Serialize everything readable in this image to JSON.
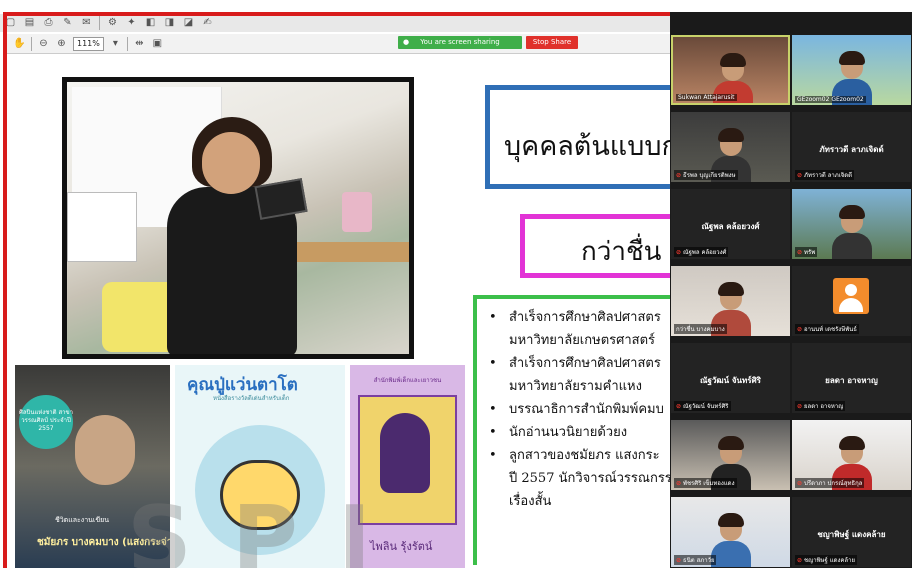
{
  "toolbar": {
    "zoom": "111%",
    "share_status": "You are screen sharing",
    "stop_share": "Stop Share"
  },
  "slide": {
    "title_line1": "บุคคลต้นแบบกา",
    "title_line2": "กว่าชื่น",
    "bio": [
      {
        "text": "สำเร็จการศึกษาศิลปศาสตร",
        "bullet": true
      },
      {
        "text": "มหาวิทยาลัยเกษตรศาสตร์",
        "bullet": false
      },
      {
        "text": "สำเร็จการศึกษาศิลปศาสตร",
        "bullet": true
      },
      {
        "text": "มหาวิทยาลัยรามคำแหง",
        "bullet": false
      },
      {
        "text": "บรรณาธิการสำนักพิมพ์คมบ",
        "bullet": true
      },
      {
        "text": "นักอ่านนวนิยายด้วยง",
        "bullet": true
      },
      {
        "text": "ลูกสาวของชมัยภร แสงกระ",
        "bullet": true
      },
      {
        "text": "ปี 2557 นักวิจารณ์วรรณกรร",
        "bullet": false
      },
      {
        "text": "เรื่องสั้น",
        "bullet": false
      }
    ],
    "book1": {
      "badge": "ศิลปินแห่งชาติ สาขาวรรณศิลป์ ประจำปี 2557",
      "caption1": "ชีวิตและงานเขียน",
      "caption2": "ชมัยภร บางคมบาง (แสงกระจ่าง)"
    },
    "book2": {
      "title": "คุณปู่แว่นตาโต",
      "subtitle": "หนังสือรางวัลดีเด่นสำหรับเด็ก"
    },
    "book3": {
      "title": "สำนักพิมพ์เด็กและเยาวชน",
      "author": "ไพลิน รุ้งรัตน์"
    }
  },
  "gallery": {
    "tiles": [
      {
        "label": "Sukwan Attajarusit",
        "name": "",
        "mic_muted": false,
        "active": true,
        "kind": "video"
      },
      {
        "label": "GEzoom02 GEzoom02",
        "name": "",
        "mic_muted": false,
        "active": false,
        "kind": "video"
      },
      {
        "label": "ธีรพล บุญเกียรติพงษ",
        "name": "",
        "mic_muted": true,
        "active": false,
        "kind": "video"
      },
      {
        "label": "ภัทราวดี ลาภเจิดดี",
        "name": "ภัทราวดี ลาภเจิดด์",
        "mic_muted": true,
        "active": false,
        "kind": "name"
      },
      {
        "label": "ณัฐพล คล้อยวงศ์",
        "name": "ณัฐพล คล้อยวงศ์",
        "mic_muted": true,
        "active": false,
        "kind": "name"
      },
      {
        "label": "ทรัพ",
        "name": "",
        "mic_muted": true,
        "active": false,
        "kind": "video"
      },
      {
        "label": "กว่าชื่น บางคมบาง",
        "name": "",
        "mic_muted": false,
        "active": false,
        "kind": "video"
      },
      {
        "label": "อานนท์ เดชรังษีพันธ์",
        "name": "",
        "mic_muted": true,
        "active": false,
        "kind": "avatar"
      },
      {
        "label": "ณัฐวัฒน์ จันทร์ศิริ",
        "name": "ณัฐวัฒน์ จันทร์ศิริ",
        "mic_muted": true,
        "active": false,
        "kind": "name"
      },
      {
        "label": "ยลดา อาจหาญ",
        "name": "ยลดา อาจหาญ",
        "mic_muted": true,
        "active": false,
        "kind": "name"
      },
      {
        "label": "พัชรศิริ เข็มทองแดง",
        "name": "",
        "mic_muted": true,
        "active": false,
        "kind": "video"
      },
      {
        "label": "ปรีดาภา ปกรณ์สุทธิกุล",
        "name": "",
        "mic_muted": true,
        "active": false,
        "kind": "video"
      },
      {
        "label": "ธนิต สภาวัย",
        "name": "",
        "mic_muted": true,
        "active": false,
        "kind": "video"
      },
      {
        "label": "ชญาพิษฐ์ แดงคล้าย",
        "name": "ชญาพิษฐ์ แดงคล้าย",
        "mic_muted": true,
        "active": false,
        "kind": "name"
      }
    ]
  },
  "watermark": "SPI"
}
